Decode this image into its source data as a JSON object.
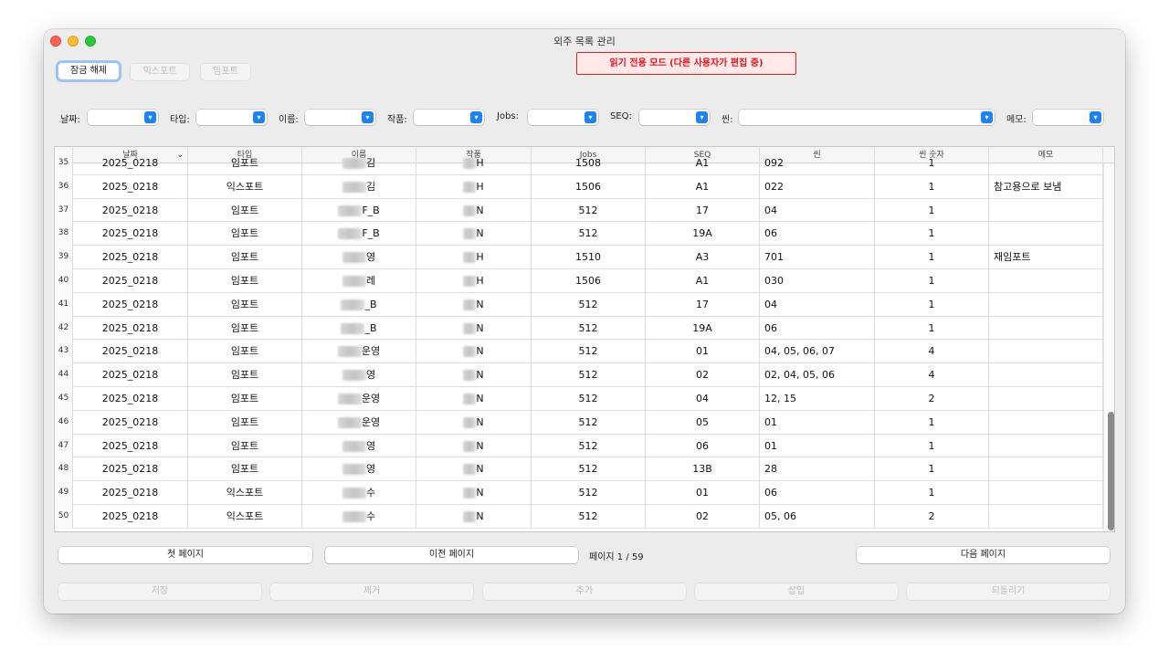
{
  "window": {
    "title": "외주 목록 관리"
  },
  "toolbar": {
    "unlock_label": "잠금 해제",
    "export_label": "익스포트",
    "import_label": "임포트",
    "readonly_banner": "읽기 전용 모드 (다른 사용자가 편집 중)"
  },
  "filters": {
    "date_label": "날짜:",
    "type_label": "타입:",
    "name_label": "이름:",
    "work_label": "작품:",
    "jobs_label": "Jobs:",
    "seq_label": "SEQ:",
    "scene_label": "씬:",
    "memo_label": "메모:"
  },
  "table": {
    "headers": [
      "날짜",
      "타입",
      "이름",
      "작품",
      "Jobs",
      "SEQ",
      "씬",
      "씬 숫자",
      "메모"
    ],
    "rows": [
      {
        "num": "35",
        "date": "2025_0218",
        "type": "임포트",
        "name": "김",
        "work": "H",
        "jobs": "1508",
        "seq": "A1",
        "scene": "092",
        "count": "1",
        "memo": ""
      },
      {
        "num": "36",
        "date": "2025_0218",
        "type": "익스포트",
        "name": "김",
        "work": "H",
        "jobs": "1506",
        "seq": "A1",
        "scene": "022",
        "count": "1",
        "memo": "참고용으로 보냄"
      },
      {
        "num": "37",
        "date": "2025_0218",
        "type": "임포트",
        "name": "F_B",
        "work": "N",
        "jobs": "512",
        "seq": "17",
        "scene": "04",
        "count": "1",
        "memo": ""
      },
      {
        "num": "38",
        "date": "2025_0218",
        "type": "임포트",
        "name": "F_B",
        "work": "N",
        "jobs": "512",
        "seq": "19A",
        "scene": "06",
        "count": "1",
        "memo": ""
      },
      {
        "num": "39",
        "date": "2025_0218",
        "type": "임포트",
        "name": "영",
        "work": "H",
        "jobs": "1510",
        "seq": "A3",
        "scene": "701",
        "count": "1",
        "memo": "재임포트"
      },
      {
        "num": "40",
        "date": "2025_0218",
        "type": "임포트",
        "name": "레",
        "work": "H",
        "jobs": "1506",
        "seq": "A1",
        "scene": "030",
        "count": "1",
        "memo": ""
      },
      {
        "num": "41",
        "date": "2025_0218",
        "type": "임포트",
        "name": "_B",
        "work": "N",
        "jobs": "512",
        "seq": "17",
        "scene": "04",
        "count": "1",
        "memo": ""
      },
      {
        "num": "42",
        "date": "2025_0218",
        "type": "임포트",
        "name": "_B",
        "work": "N",
        "jobs": "512",
        "seq": "19A",
        "scene": "06",
        "count": "1",
        "memo": ""
      },
      {
        "num": "43",
        "date": "2025_0218",
        "type": "임포트",
        "name": "운영",
        "work": "N",
        "jobs": "512",
        "seq": "01",
        "scene": "04, 05, 06, 07",
        "count": "4",
        "memo": ""
      },
      {
        "num": "44",
        "date": "2025_0218",
        "type": "임포트",
        "name": "영",
        "work": "N",
        "jobs": "512",
        "seq": "02",
        "scene": "02, 04, 05, 06",
        "count": "4",
        "memo": ""
      },
      {
        "num": "45",
        "date": "2025_0218",
        "type": "임포트",
        "name": "운영",
        "work": "N",
        "jobs": "512",
        "seq": "04",
        "scene": "12, 15",
        "count": "2",
        "memo": ""
      },
      {
        "num": "46",
        "date": "2025_0218",
        "type": "임포트",
        "name": "운영",
        "work": "N",
        "jobs": "512",
        "seq": "05",
        "scene": "01",
        "count": "1",
        "memo": ""
      },
      {
        "num": "47",
        "date": "2025_0218",
        "type": "임포트",
        "name": "영",
        "work": "N",
        "jobs": "512",
        "seq": "06",
        "scene": "01",
        "count": "1",
        "memo": ""
      },
      {
        "num": "48",
        "date": "2025_0218",
        "type": "임포트",
        "name": "영",
        "work": "N",
        "jobs": "512",
        "seq": "13B",
        "scene": "28",
        "count": "1",
        "memo": ""
      },
      {
        "num": "49",
        "date": "2025_0218",
        "type": "익스포트",
        "name": "수",
        "work": "N",
        "jobs": "512",
        "seq": "01",
        "scene": "06",
        "count": "1",
        "memo": ""
      },
      {
        "num": "50",
        "date": "2025_0218",
        "type": "익스포트",
        "name": "수",
        "work": "N",
        "jobs": "512",
        "seq": "02",
        "scene": "05, 06",
        "count": "2",
        "memo": ""
      }
    ]
  },
  "pagination": {
    "first_label": "첫 페이지",
    "prev_label": "이전 페이지",
    "info": "페이지 1 / 59",
    "next_label": "다음 페이지"
  },
  "actions": {
    "save_label": "저장",
    "remove_label": "제거",
    "add_label": "추가",
    "insert_label": "삽입",
    "revert_label": "되돌리기"
  }
}
